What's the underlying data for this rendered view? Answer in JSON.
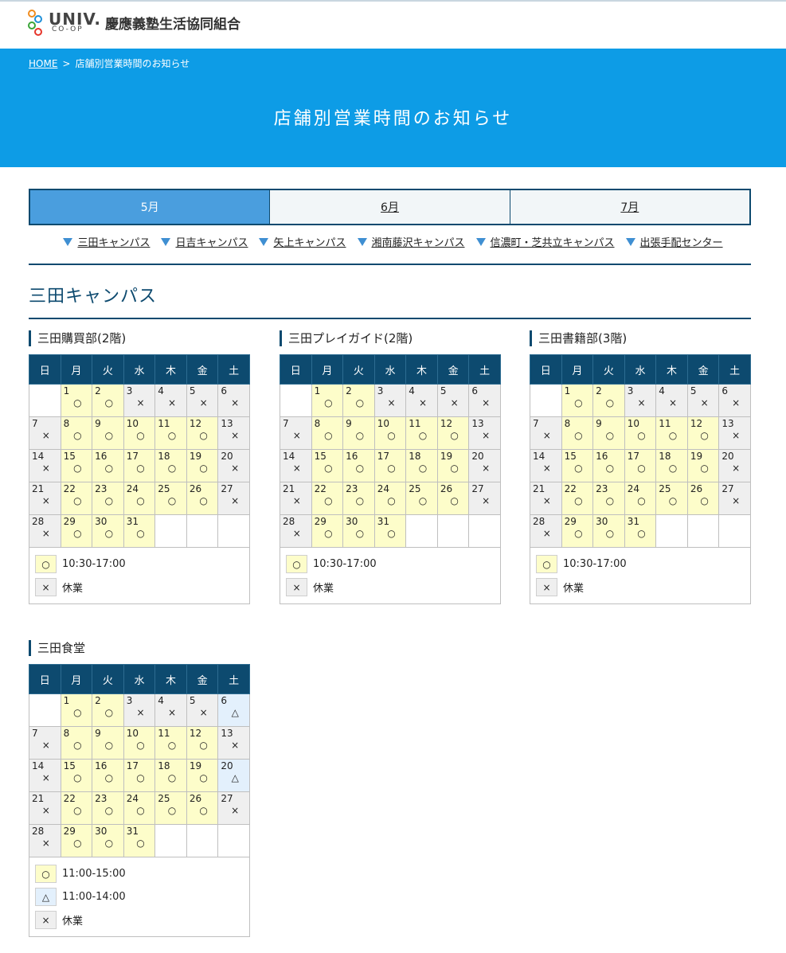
{
  "header": {
    "logo_text": "UNIV.",
    "logo_sub": "CO-OP",
    "org_name": "慶應義塾生活協同組合"
  },
  "breadcrumb": {
    "home": "HOME",
    "sep": ">",
    "current": "店舗別営業時間のお知らせ"
  },
  "page_title": "店舗別営業時間のお知らせ",
  "tabs": [
    {
      "label": "5月",
      "active": true
    },
    {
      "label": "6月",
      "active": false
    },
    {
      "label": "7月",
      "active": false
    }
  ],
  "campus_links": [
    "三田キャンパス",
    "日吉キャンパス",
    "矢上キャンパス",
    "湘南藤沢キャンパス",
    "信濃町・芝共立キャンパス",
    "出張手配センター"
  ],
  "section_title": "三田キャンパス",
  "weekdays": [
    "日",
    "月",
    "火",
    "水",
    "木",
    "金",
    "土"
  ],
  "marks": {
    "open": "○",
    "closed": "×",
    "short": "△"
  },
  "stores": [
    {
      "name": "三田購買部(2階)",
      "days": [
        "o",
        "o",
        "x",
        "x",
        "x",
        "x",
        "x",
        "o",
        "o",
        "o",
        "o",
        "o",
        "x",
        "x",
        "o",
        "o",
        "o",
        "o",
        "o",
        "x",
        "x",
        "o",
        "o",
        "o",
        "o",
        "o",
        "x",
        "x",
        "o",
        "o",
        "o"
      ],
      "legend": [
        {
          "mark": "open",
          "text": "10:30-17:00"
        },
        {
          "mark": "closed",
          "text": "休業"
        }
      ]
    },
    {
      "name": "三田プレイガイド(2階)",
      "days": [
        "o",
        "o",
        "x",
        "x",
        "x",
        "x",
        "x",
        "o",
        "o",
        "o",
        "o",
        "o",
        "x",
        "x",
        "o",
        "o",
        "o",
        "o",
        "o",
        "x",
        "x",
        "o",
        "o",
        "o",
        "o",
        "o",
        "x",
        "x",
        "o",
        "o",
        "o"
      ],
      "legend": [
        {
          "mark": "open",
          "text": "10:30-17:00"
        },
        {
          "mark": "closed",
          "text": "休業"
        }
      ]
    },
    {
      "name": "三田書籍部(3階)",
      "days": [
        "o",
        "o",
        "x",
        "x",
        "x",
        "x",
        "x",
        "o",
        "o",
        "o",
        "o",
        "o",
        "x",
        "x",
        "o",
        "o",
        "o",
        "o",
        "o",
        "x",
        "x",
        "o",
        "o",
        "o",
        "o",
        "o",
        "x",
        "x",
        "o",
        "o",
        "o"
      ],
      "legend": [
        {
          "mark": "open",
          "text": "10:30-17:00"
        },
        {
          "mark": "closed",
          "text": "休業"
        }
      ]
    },
    {
      "name": "三田食堂",
      "days": [
        "o",
        "o",
        "x",
        "x",
        "x",
        "t",
        "x",
        "o",
        "o",
        "o",
        "o",
        "o",
        "x",
        "x",
        "o",
        "o",
        "o",
        "o",
        "o",
        "t",
        "x",
        "o",
        "o",
        "o",
        "o",
        "o",
        "x",
        "x",
        "o",
        "o",
        "o"
      ],
      "legend": [
        {
          "mark": "open",
          "text": "11:00-15:00"
        },
        {
          "mark": "short",
          "text": "11:00-14:00"
        },
        {
          "mark": "closed",
          "text": "休業"
        }
      ]
    }
  ]
}
